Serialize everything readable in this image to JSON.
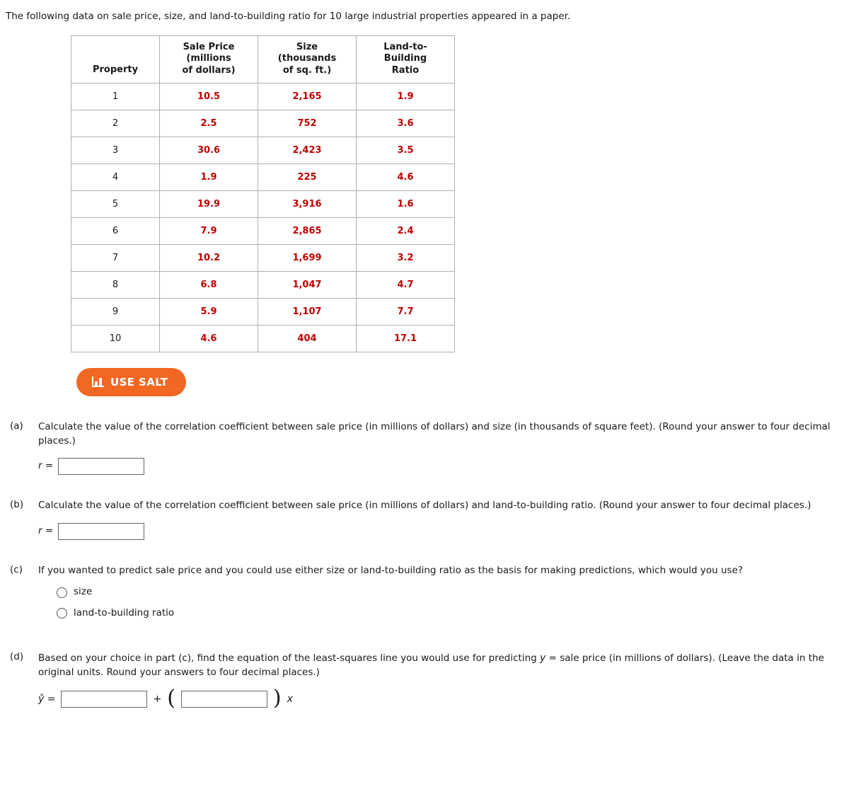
{
  "intro": "The following data on sale price, size, and land-to-building ratio for 10 large industrial properties appeared in a paper.",
  "table": {
    "headers": {
      "property": "Property",
      "sale_price": [
        "Sale Price",
        "(millions",
        "of dollars)"
      ],
      "size": [
        "Size",
        "(thousands",
        "of sq. ft.)"
      ],
      "ratio": [
        "Land-to-",
        "Building",
        "Ratio"
      ]
    },
    "rows": [
      {
        "property": "1",
        "sale_price": "10.5",
        "size": "2,165",
        "ratio": "1.9"
      },
      {
        "property": "2",
        "sale_price": "2.5",
        "size": "752",
        "ratio": "3.6"
      },
      {
        "property": "3",
        "sale_price": "30.6",
        "size": "2,423",
        "ratio": "3.5"
      },
      {
        "property": "4",
        "sale_price": "1.9",
        "size": "225",
        "ratio": "4.6"
      },
      {
        "property": "5",
        "sale_price": "19.9",
        "size": "3,916",
        "ratio": "1.6"
      },
      {
        "property": "6",
        "sale_price": "7.9",
        "size": "2,865",
        "ratio": "2.4"
      },
      {
        "property": "7",
        "sale_price": "10.2",
        "size": "1,699",
        "ratio": "3.2"
      },
      {
        "property": "8",
        "sale_price": "6.8",
        "size": "1,047",
        "ratio": "4.7"
      },
      {
        "property": "9",
        "sale_price": "5.9",
        "size": "1,107",
        "ratio": "7.7"
      },
      {
        "property": "10",
        "sale_price": "4.6",
        "size": "404",
        "ratio": "17.1"
      }
    ]
  },
  "salt_button": {
    "label": "USE SALT",
    "color": "#f26722"
  },
  "questions": {
    "a": {
      "label": "(a)",
      "text": "Calculate the value of the correlation coefficient between sale price (in millions of dollars) and size (in thousands of square feet). (Round your answer to four decimal places.)",
      "answer_label": "r =",
      "answer_value": ""
    },
    "b": {
      "label": "(b)",
      "text": "Calculate the value of the correlation coefficient between sale price (in millions of dollars) and land-to-building ratio. (Round your answer to four decimal places.)",
      "answer_label": "r =",
      "answer_value": ""
    },
    "c": {
      "label": "(c)",
      "text": "If you wanted to predict sale price and you could use either size or land-to-building ratio as the basis for making predictions, which would you use?",
      "options": [
        "size",
        "land-to-building ratio"
      ]
    },
    "d": {
      "label": "(d)",
      "text_part1": "Based on your choice in part (c), find the equation of the least-squares line you would use for predicting ",
      "text_y": "y",
      "text_part2": " = sale price (in millions of dollars). (Leave the data in the original units. Round your answers to four decimal places.)",
      "eq_lhs": "ŷ =",
      "eq_plus": "+",
      "eq_x": "x",
      "intercept_value": "",
      "slope_value": ""
    }
  }
}
